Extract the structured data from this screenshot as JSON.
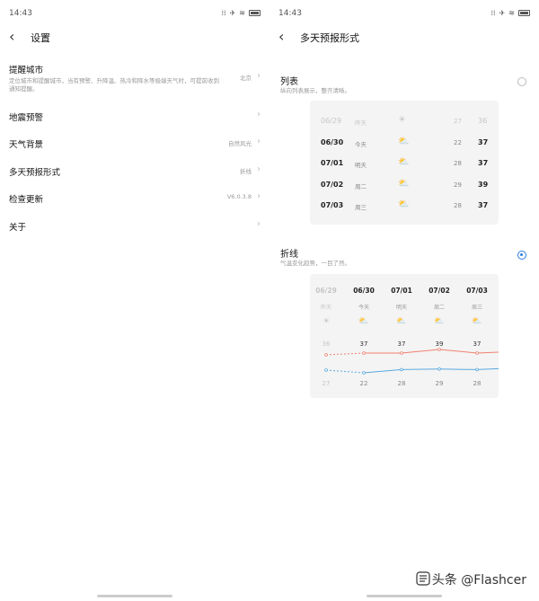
{
  "left": {
    "status": {
      "time": "14:43"
    },
    "title": "设置",
    "rows": [
      {
        "label": "提醒城市",
        "desc": "定位城市和提醒城市，当有预警、升降温、热冷和降水等极端天气时，可提前收到通知提醒。",
        "value": "北京"
      },
      {
        "label": "地震预警",
        "desc": "",
        "value": ""
      },
      {
        "label": "天气背景",
        "desc": "",
        "value": "自然风光"
      },
      {
        "label": "多天预报形式",
        "desc": "",
        "value": "折线"
      },
      {
        "label": "检查更新",
        "desc": "",
        "value": "V6.0.3.8"
      },
      {
        "label": "关于",
        "desc": "",
        "value": ""
      }
    ]
  },
  "right": {
    "status": {
      "time": "14:43"
    },
    "title": "多天预报形式",
    "list_option": {
      "title": "列表",
      "desc": "纵向列表展示，整齐清晰。",
      "selected": false
    },
    "line_option": {
      "title": "折线",
      "desc": "气温变化趋势，一目了然。",
      "selected": true
    },
    "days": [
      {
        "date": "06/29",
        "week": "昨天",
        "icon": "sunny-icon",
        "low": "27",
        "high": "36",
        "past": true
      },
      {
        "date": "06/30",
        "week": "今天",
        "icon": "partly-cloudy-icon",
        "low": "22",
        "high": "37",
        "past": false
      },
      {
        "date": "07/01",
        "week": "明天",
        "icon": "partly-cloudy-icon",
        "low": "28",
        "high": "37",
        "past": false
      },
      {
        "date": "07/02",
        "week": "周二",
        "icon": "partly-cloudy-icon",
        "low": "29",
        "high": "39",
        "past": false
      },
      {
        "date": "07/03",
        "week": "周三",
        "icon": "partly-cloudy-icon",
        "low": "28",
        "high": "37",
        "past": false
      }
    ],
    "colors": {
      "high_line": "#f08070",
      "low_line": "#5aa8e0",
      "radio": "#2f7de1"
    }
  },
  "watermark": "头条 @Flashcer"
}
